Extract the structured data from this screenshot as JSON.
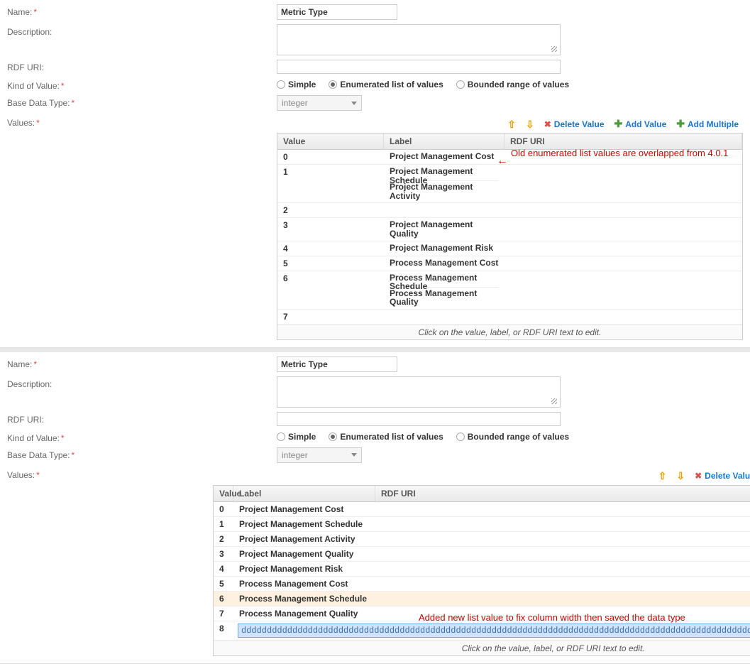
{
  "labels": {
    "name": "Name:",
    "description": "Description:",
    "rdf": "RDF URI:",
    "kind": "Kind of Value:",
    "base": "Base Data Type:",
    "values": "Values:"
  },
  "nameValue": "Metric Type",
  "kind": {
    "simple": "Simple",
    "enum": "Enumerated list of values",
    "bounded": "Bounded range of values",
    "selected": "enum"
  },
  "baseDataType": "integer",
  "toolbar": {
    "delete": "Delete Value",
    "add": "Add Value",
    "addMultiple": "Add Multiple"
  },
  "tableHeaders": {
    "value": "Value",
    "label": "Label",
    "rdf": "RDF URI"
  },
  "hint": "Click on the value, label, or RDF URI text to edit.",
  "panel1": {
    "annotation": "Old enumerated list values are overlapped from 4.0.1",
    "rows": [
      {
        "v": "0",
        "l": "Project Management Cost"
      },
      {
        "v": "1",
        "l": "Project Management Schedule",
        "overlapWith": "Project Management Activity"
      },
      {
        "v": "2",
        "l": ""
      },
      {
        "v": "3",
        "l": "Project Management Quality"
      },
      {
        "v": "4",
        "l": "Project Management Risk"
      },
      {
        "v": "5",
        "l": "Process Management Cost"
      },
      {
        "v": "6",
        "l": "Process Management Schedule",
        "overlapWith": "Process Management Quality"
      },
      {
        "v": "7",
        "l": ""
      }
    ]
  },
  "panel2": {
    "annotation": "Added new list value to fix column width then saved the data type",
    "rows": [
      {
        "v": "0",
        "l": "Project Management Cost"
      },
      {
        "v": "1",
        "l": "Project Management Schedule"
      },
      {
        "v": "2",
        "l": "Project Management Activity"
      },
      {
        "v": "3",
        "l": "Project Management Quality"
      },
      {
        "v": "4",
        "l": "Project Management Risk"
      },
      {
        "v": "5",
        "l": "Process Management Cost"
      },
      {
        "v": "6",
        "l": "Process Management Schedule",
        "highlight": true
      },
      {
        "v": "7",
        "l": "Process Management Quality"
      },
      {
        "v": "8",
        "l": "dddddddddddddddddddddddddddddddddddddddddddddddddddddddddddddddddddddddddddddddddddddddddddddddddddddddddddddddddddddddddddddd",
        "edit": true
      }
    ]
  }
}
